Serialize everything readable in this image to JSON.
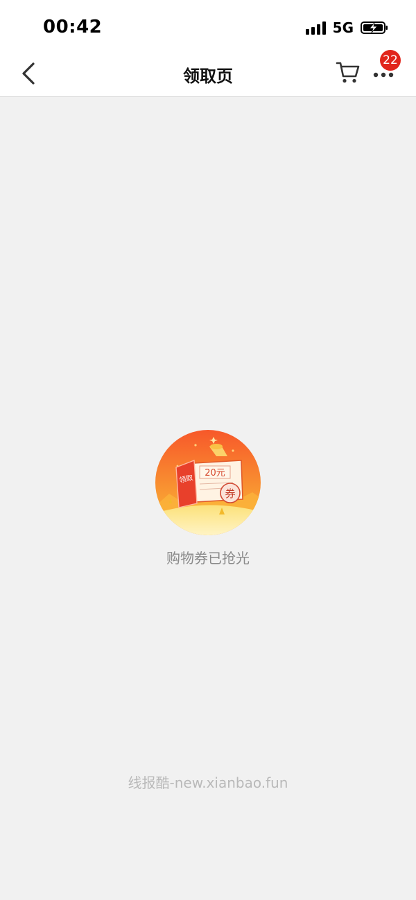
{
  "status_bar": {
    "time": "00:42",
    "network": "5G"
  },
  "nav": {
    "title": "领取页",
    "badge_count": "22"
  },
  "content": {
    "illustration": {
      "tag_text": "领取",
      "amount_text": "20元",
      "stamp_text": "券"
    },
    "empty_message": "购物券已抢光",
    "watermark": "线报酷-new.xianbao.fun"
  },
  "colors": {
    "accent_red": "#e1251b",
    "illustration_orange": "#f26a1f"
  }
}
